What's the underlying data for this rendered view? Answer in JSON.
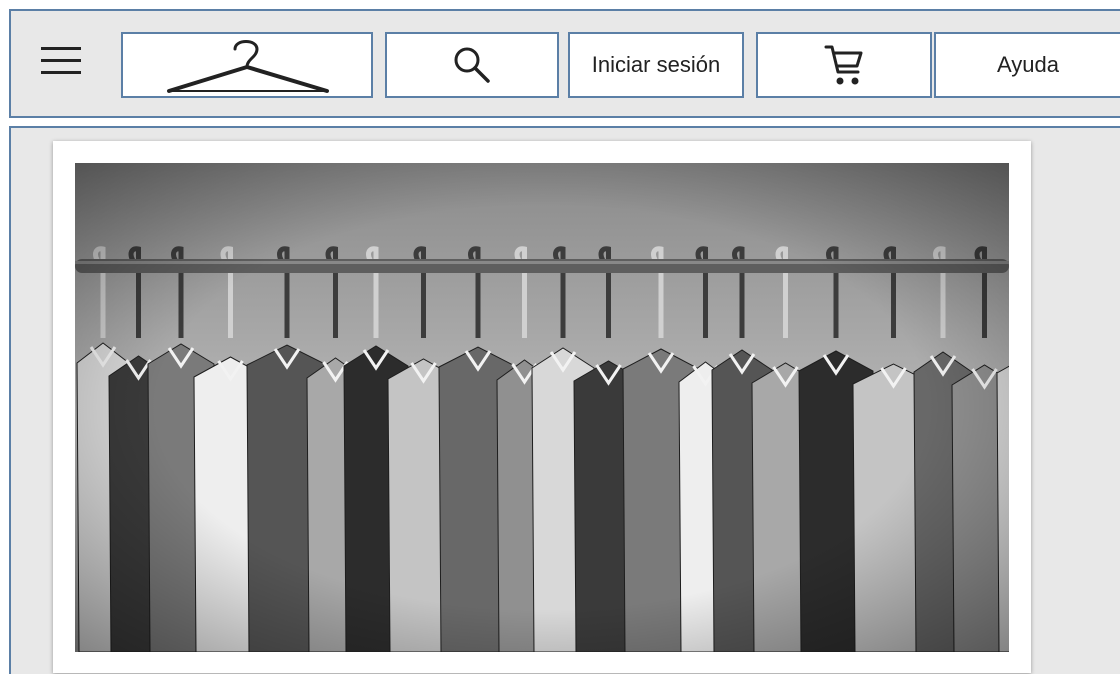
{
  "header": {
    "menu_icon": "hamburger-menu-icon",
    "logo_icon": "clothes-hanger-logo-icon",
    "search_icon": "search-icon",
    "login_label": "Iniciar sesión",
    "cart_icon": "shopping-cart-icon",
    "help_label": "Ayuda"
  },
  "hero": {
    "image": "clothes-rack-photo"
  },
  "colors": {
    "border": "#5b7fa6",
    "panel_bg": "#e8e8e8"
  }
}
